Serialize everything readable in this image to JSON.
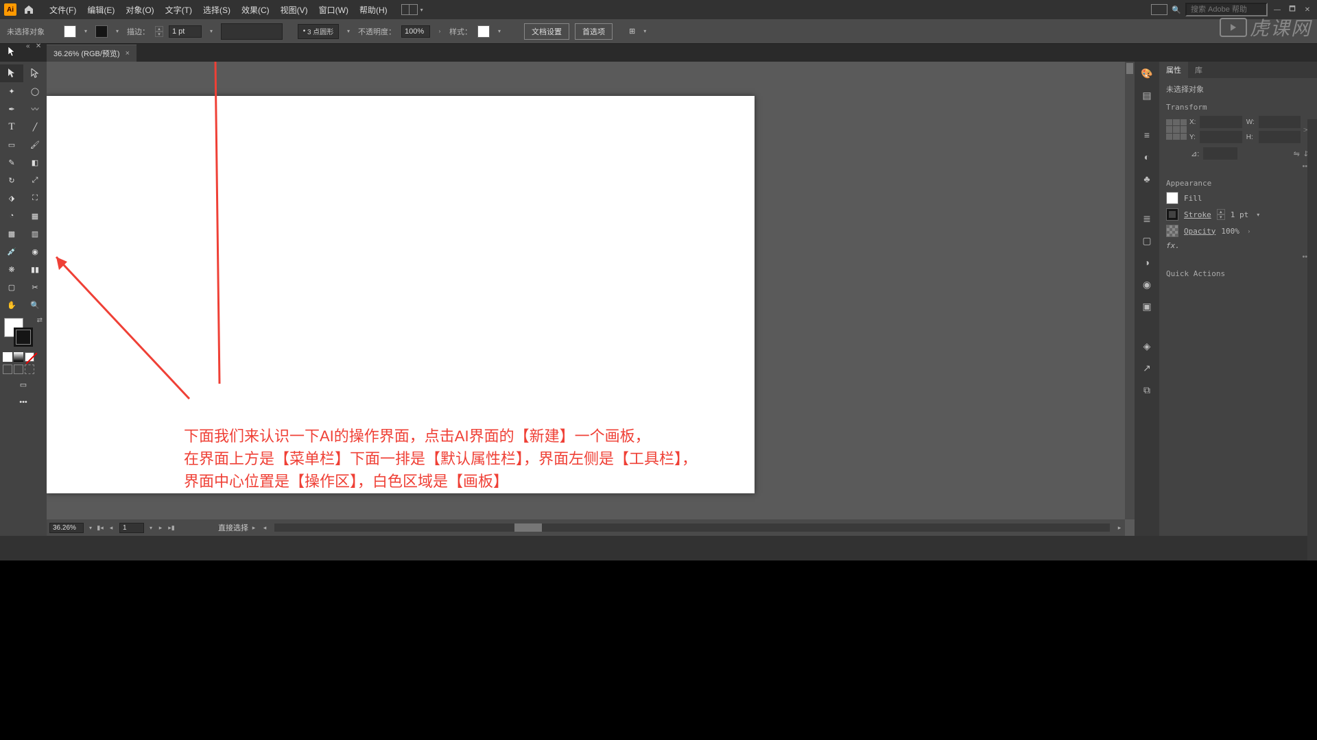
{
  "menubar": {
    "items": [
      "文件(F)",
      "编辑(E)",
      "对象(O)",
      "文字(T)",
      "选择(S)",
      "效果(C)",
      "视图(V)",
      "窗口(W)",
      "帮助(H)"
    ],
    "search_placeholder": "搜索 Adobe 帮助"
  },
  "control_bar": {
    "no_selection": "未选择对象",
    "stroke_label": "描边：",
    "stroke_weight": "1 pt",
    "brush_label": "3 点圆形",
    "opacity_label": "不透明度：",
    "opacity_value": "100%",
    "style_label": "样式：",
    "doc_setup": "文档设置",
    "prefs": "首选项"
  },
  "document": {
    "tab_title": "36.26% (RGB/预览)",
    "zoom": "36.26%",
    "artboard_num": "1",
    "status": "直接选择"
  },
  "canvas_annotation": {
    "line1": "下面我们来认识一下AI的操作界面，点击AI界面的【新建】一个画板，",
    "line2": "在界面上方是【菜单栏】下面一排是【默认属性栏】，界面左侧是【工具栏】，",
    "line3": "界面中心位置是【操作区】，白色区域是【画板】"
  },
  "properties": {
    "tabs": {
      "active": "属性",
      "lib": "库"
    },
    "no_sel": "未选择对象",
    "transform": {
      "title": "Transform",
      "x_label": "X:",
      "y_label": "Y:",
      "w_label": "W:",
      "h_label": "H:",
      "angle_label": "⊿:"
    },
    "appearance": {
      "title": "Appearance",
      "fill": "Fill",
      "stroke": "Stroke",
      "stroke_val": "1 pt",
      "opacity": "Opacity",
      "opacity_val": "100%",
      "fx": "fx."
    },
    "quick": "Quick Actions"
  },
  "watermark": "虎课网"
}
